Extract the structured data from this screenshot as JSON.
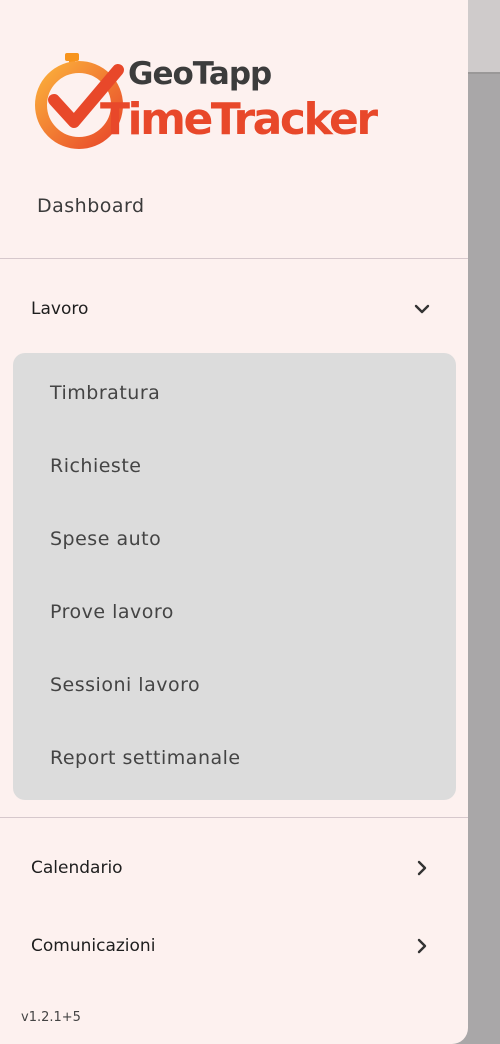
{
  "logo": {
    "line1": "GeoTapp",
    "line2": "TimeTracker",
    "icon": "stopwatch-check-icon",
    "colors": {
      "accent": "#e8482a",
      "dark": "#3c3c3c",
      "orange": "#f7941d"
    }
  },
  "nav": {
    "dashboard": "Dashboard",
    "lavoro": {
      "label": "Lavoro",
      "icon": "chevron-down-icon",
      "expanded": true,
      "items": [
        {
          "label": "Timbratura"
        },
        {
          "label": "Richieste"
        },
        {
          "label": "Spese auto"
        },
        {
          "label": "Prove lavoro"
        },
        {
          "label": "Sessioni lavoro"
        },
        {
          "label": "Report settimanale"
        }
      ]
    },
    "calendario": {
      "label": "Calendario",
      "icon": "chevron-right-icon"
    },
    "comunicazioni": {
      "label": "Comunicazioni",
      "icon": "chevron-right-icon"
    }
  },
  "version": "v1.2.1+5",
  "colors": {
    "drawer_bg": "#fdf1ef",
    "submenu_bg": "#dcdcdc",
    "scrim": "#a9a7a8"
  }
}
